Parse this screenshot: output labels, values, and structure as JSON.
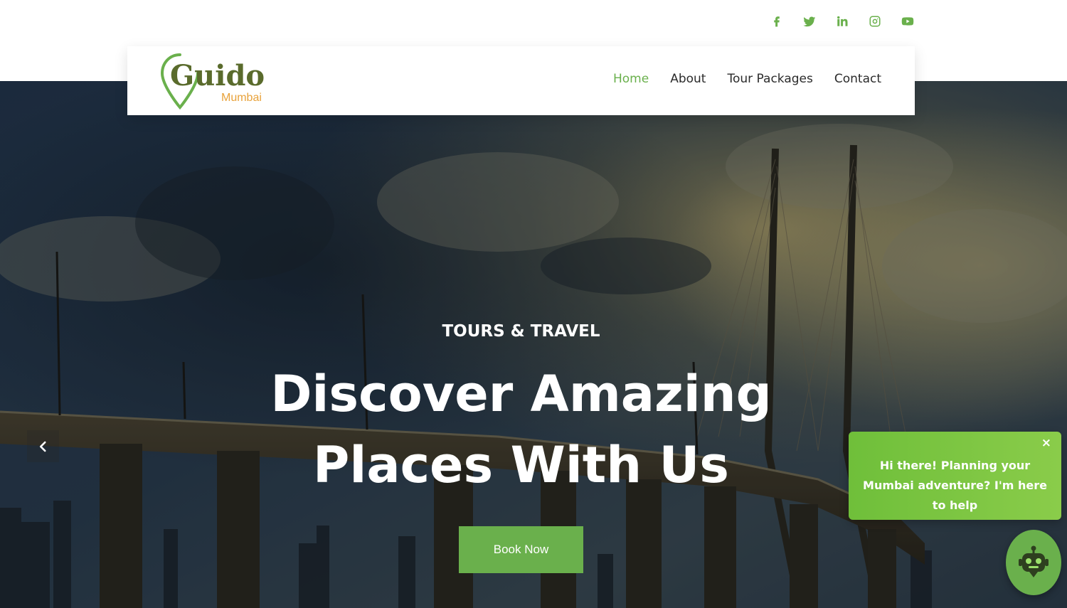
{
  "social": {
    "icons": [
      "facebook-icon",
      "twitter-icon",
      "linkedin-icon",
      "instagram-icon",
      "youtube-icon"
    ],
    "color": "#6ab04c"
  },
  "brand": {
    "name": "Guido",
    "subtitle": "Mumbai",
    "name_color": "#5a6b2c",
    "subtitle_color": "#e8a23a",
    "pin_color": "#6ab04c"
  },
  "nav": {
    "items": [
      {
        "label": "Home",
        "active": true
      },
      {
        "label": "About",
        "active": false
      },
      {
        "label": "Tour Packages",
        "active": false
      },
      {
        "label": "Contact",
        "active": false
      }
    ],
    "active_color": "#6ab04c"
  },
  "hero": {
    "eyebrow": "TOURS & TRAVEL",
    "headline_line1": "Discover Amazing",
    "headline_line2": "Places With Us",
    "cta_label": "Book Now",
    "cta_color": "#6ab04c",
    "prev_icon": "chevron-left-icon",
    "background": "mumbai-sea-link-bridge-photo"
  },
  "chat": {
    "message": "Hi there! Planning your Mumbai adventure? I'm here to help",
    "close_label": "×",
    "bot_icon": "robot-icon",
    "color": "#6ab04c"
  }
}
